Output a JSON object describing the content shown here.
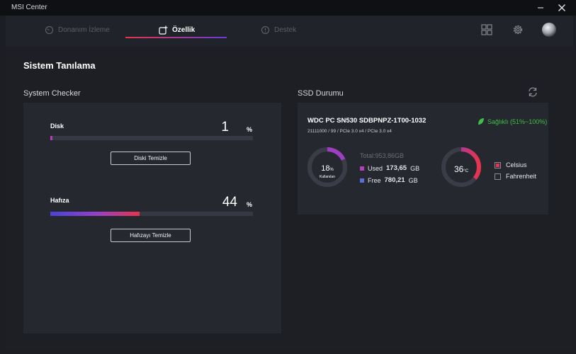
{
  "app": {
    "title": "MSI Center"
  },
  "nav": {
    "tabs": [
      {
        "label": "Donanım İzleme",
        "icon": "monitor-gauge-icon",
        "active": false
      },
      {
        "label": "Özellik",
        "icon": "feature-add-icon",
        "active": true
      },
      {
        "label": "Destek",
        "icon": "support-alert-icon",
        "active": false
      }
    ],
    "icons": [
      "grid-apps-icon",
      "gear-icon",
      "user-avatar"
    ]
  },
  "page": {
    "title": "Sistem Tanılama"
  },
  "system_checker": {
    "title": "System Checker",
    "disk": {
      "label": "Disk",
      "value": "1",
      "unit": "%",
      "percent": 1,
      "button": "Diski Temizle"
    },
    "memory": {
      "label": "Hafıza",
      "value": "44",
      "unit": "%",
      "percent": 44,
      "button": "Hafızayı Temizle"
    }
  },
  "ssd": {
    "title": "SSD Durumu",
    "name": "WDC PC SN530 SDBPNPZ-1T00-1032",
    "sub": "21111000 / 99 / PCIe 3.0 x4 / PCIe 3.0 x4",
    "health": "Sağlıklı (51%~100%)",
    "usage_value": "18",
    "usage_unit": "%",
    "usage_label": "Kullanılan",
    "usage_percent": 18,
    "total": "Total:953,86GB",
    "used_label": "Used",
    "used_value": "173,65",
    "used_unit": "GB",
    "free_label": "Free",
    "free_value": "780,21",
    "free_unit": "GB",
    "temp_value": "36",
    "temp_unit": "°C",
    "temp_fraction": 0.36,
    "celsius": "Celsius",
    "fahrenheit": "Fahrenheit",
    "unit_selected": "Celsius"
  },
  "colors": {
    "accent_red": "#e8334c",
    "accent_purple": "#6a3bdb",
    "used_square": "#b63fb9",
    "free_square": "#5a6fd6",
    "health_green": "#3fbf47"
  }
}
